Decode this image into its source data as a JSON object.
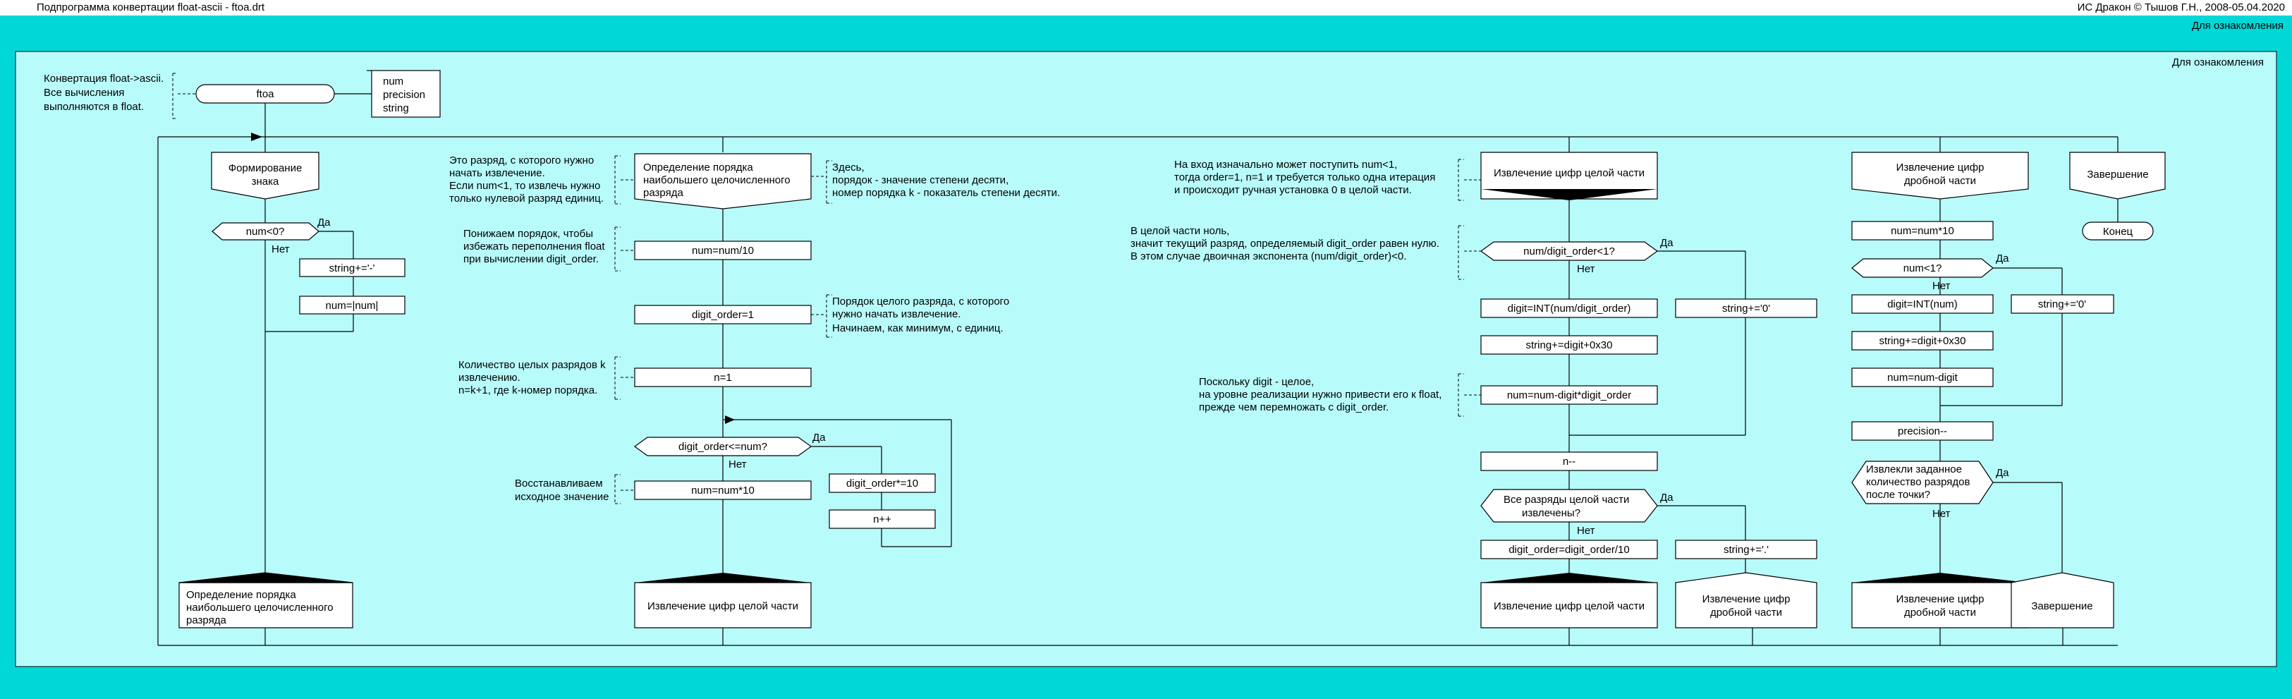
{
  "window": {
    "title": "Подпрограмма конвертации float-ascii - ftoa.drt",
    "app_credit": "ИС Дракон © Тышов Г.Н., 2008-05.04.2020",
    "outer_label": "Для ознакомления",
    "inner_label": "Для ознакомления"
  },
  "colors": {
    "frame": "#00d8d8",
    "panel": "#b8fbfb",
    "box": "#ffffff"
  },
  "header": {
    "comment": [
      "Конвертация float->ascii.",
      "Все вычисления",
      "выполняются в float."
    ],
    "title": "ftoa",
    "params": [
      "num",
      "precision",
      "string"
    ]
  },
  "branch1": {
    "head": [
      "Формирование",
      "знака"
    ],
    "cond": "num<0?",
    "yes": "Да",
    "no": "Нет",
    "act1": "string+='-'",
    "act2": "num=|num|",
    "addr": [
      "Определение порядка",
      "наибольшего целочисленного",
      "разряда"
    ]
  },
  "branch2": {
    "head": [
      "Определение порядка",
      "наибольшего целочисленного",
      "разряда"
    ],
    "note_head": [
      "Это разряд, с которого нужно",
      "начать извлечение.",
      "Если num<1, то извлечь нужно",
      "только нулевой разряд единиц."
    ],
    "note_right": [
      "Здесь,",
      "порядок - значение степени десяти,",
      "номер порядка k - показатель степени десяти."
    ],
    "act1": "num=num/10",
    "note1": [
      "Понижаем порядок, чтобы",
      "избежать переполнения float",
      "при вычислении digit_order."
    ],
    "act2": "digit_order=1",
    "note2": [
      "Порядок целого разряда, с которого",
      "нужно начать извлечение.",
      "Начинаем, как минимум, с единиц."
    ],
    "act3": "n=1",
    "note3": [
      "Количество целых разрядов k",
      "извлечению.",
      "n=k+1, где k-номер порядка."
    ],
    "cond": "digit_order<=num?",
    "yes": "Да",
    "no": "Нет",
    "loop1": "digit_order*=10",
    "loop2": "n++",
    "act4": "num=num*10",
    "note4": [
      "Восстанавливаем",
      "исходное значение"
    ],
    "addr": "Извлечение цифр целой части"
  },
  "branch3": {
    "head": "Извлечение цифр целой части",
    "note_head": [
      "На вход изначально может поступить num<1,",
      "тогда order=1, n=1 и требуется только одна итерация",
      "и происходит ручная установка 0 в целой части."
    ],
    "note_cond": [
      "В целой части ноль,",
      "значит текущий разряд, определяемый digit_order равен нулю.",
      "В этом случае двоичная экспонента (num/digit_order)<0."
    ],
    "cond1": "num/digit_order<1?",
    "yes1": "Да",
    "no1": "Нет",
    "yes_act": "string+='0'",
    "act1": "digit=INT(num/digit_order)",
    "act2": "string+=digit+0x30",
    "act3": "num=num-digit*digit_order",
    "note_act3": [
      "Поскольку digit - целое,",
      "на уровне реализации нужно привести его к float,",
      "прежде чем перемножать с digit_order."
    ],
    "act4": "n--",
    "cond2": [
      "Все разряды целой части",
      "извлечены?"
    ],
    "yes2": "Да",
    "no2": "Нет",
    "act5": "digit_order=digit_order/10",
    "yes2_act": "string+='.'",
    "addr1": "Извлечение цифр целой части",
    "addr2": [
      "Извлечение цифр",
      "дробной части"
    ]
  },
  "branch4": {
    "head": [
      "Извлечение цифр",
      "дробной части"
    ],
    "act1": "num=num*10",
    "cond1": "num<1?",
    "yes1": "Да",
    "no1": "Нет",
    "yes_act": "string+='0'",
    "act2": "digit=INT(num)",
    "act3": "string+=digit+0x30",
    "act4": "num=num-digit",
    "act5": "precision--",
    "cond2": [
      "Извлекли заданное",
      "количество разрядов",
      "после точки?"
    ],
    "yes2": "Да",
    "no2": "Нет",
    "addr1": [
      "Извлечение цифр",
      "дробной части"
    ],
    "addr2": "Завершение"
  },
  "branch5": {
    "head": "Завершение",
    "end": "Конец"
  }
}
